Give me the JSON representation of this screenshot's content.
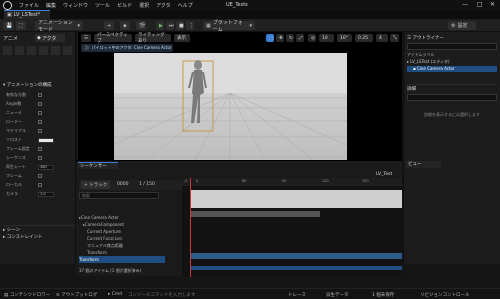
{
  "window": {
    "title": "UE_Tests",
    "minimize": "—",
    "maximize": "□",
    "close": "✕"
  },
  "menu": [
    "ファイル",
    "編集",
    "ウィンドウ",
    "ツール",
    "ビルド",
    "選択",
    "アクタ",
    "ヘルプ"
  ],
  "doc_tab": {
    "label": "LV_LSTest*"
  },
  "toolbar": {
    "mode": "アニメーションモード",
    "platform": "プラットフォーム",
    "settings": "設定"
  },
  "left_panel": {
    "tabs": [
      "アニメ",
      "アクタ"
    ],
    "section": "アニメーションの構成",
    "rows": [
      "有効な分割",
      "Angle数",
      "ニューメ",
      "ローテー",
      "マテリアル",
      "ソロスト",
      "フレーム設定",
      "シーケンス",
      "再生レート",
      "フレーム",
      "ローカル",
      "カメラ"
    ],
    "color_value": "",
    "num_value": "360",
    "num_value2": "1.0",
    "section2": "シーン",
    "section3": "コンストレイント"
  },
  "viewport": {
    "perspective": "パースペクティブ",
    "lighting": "ライティングあり",
    "display": "表示",
    "breadcrumb": "パイロット中のアクタ: Cine Camera Actor",
    "speed": "10",
    "angle": "10°",
    "scale": "0.25",
    "cam": "4"
  },
  "sequencer": {
    "tab": "シーケンサー",
    "sequence_name": "LV_Test",
    "add_track": "+ トラック",
    "fps": "30 fps",
    "time_a": "0000",
    "time_b": "1 / 150",
    "search_placeholder": "検索",
    "tracks": [
      {
        "label": "Cine Camera Actor",
        "indent": 0
      },
      {
        "label": "CameraComponent",
        "indent": 1
      },
      {
        "label": "Current Aperture",
        "indent": 2
      },
      {
        "label": "Current Focal Len",
        "indent": 2
      },
      {
        "label": "マニュアル焦点距離",
        "indent": 2
      },
      {
        "label": "Transform",
        "indent": 2
      },
      {
        "label": "Transform",
        "indent": 0
      }
    ],
    "item_count": "37 個のアイテム (1 個が選択済み)",
    "frame_marker": "0",
    "ruler": [
      "-0",
      "0",
      "60",
      "90",
      "120",
      "150"
    ]
  },
  "right_panel": {
    "outliner_title": "アウトライナー",
    "outliner_rows": [
      "アイテムラベル",
      "LV_LSTest (エディタ)",
      "Cine Camera Actor"
    ],
    "details_title": "詳細",
    "details_placeholder": "詳細を表示するには選択します",
    "view_tab": "ビュー",
    "transform_label": "トランスフォーム"
  },
  "status": {
    "content_drawer": "コンテンツドロワー",
    "output_log": "アウトプットログ",
    "cmd": "Cmd",
    "cmd_placeholder": "コンソールコマンドを入力します",
    "trace": "トレース",
    "derived_data": "派生データ",
    "unsaved": "1 個未保存",
    "source_control": "リビジョンコントロール"
  },
  "colors": {
    "accent": "#3a7fd5",
    "track_highlight": "#2d5c8a",
    "selected_row": "#1f4f82"
  }
}
